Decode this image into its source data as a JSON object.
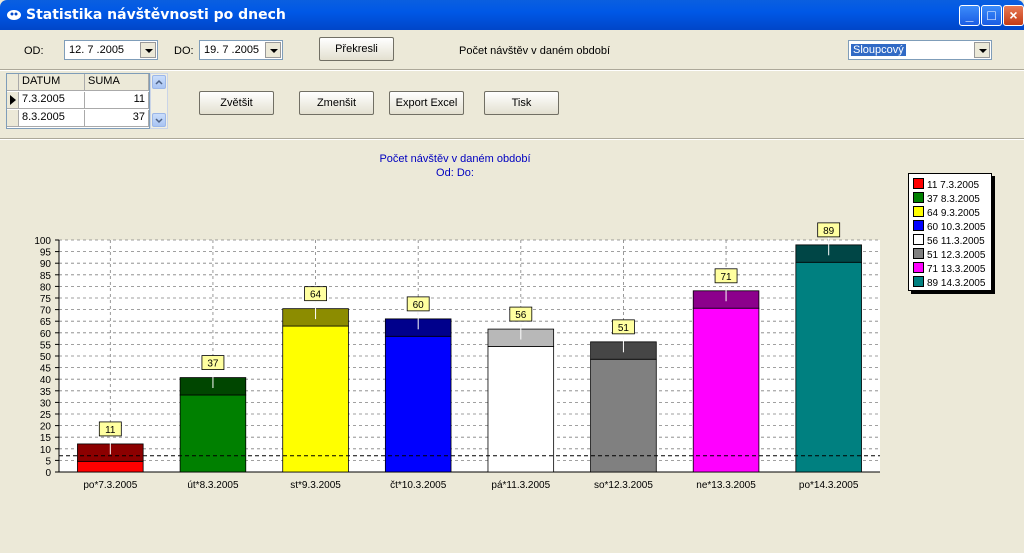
{
  "window": {
    "title": "Statistika návštěvnosti po dnech"
  },
  "filters": {
    "od_label": "OD:",
    "od_value": "12. 7 .2005",
    "do_label": "DO:",
    "do_value": "19. 7 .2005",
    "redraw_label": "Překresli",
    "period_label": "Počet návštěv v daném období",
    "chart_type_value": "Sloupcový"
  },
  "table": {
    "headers": [
      "DATUM",
      "SUMA"
    ],
    "rows": [
      {
        "datum": "7.3.2005",
        "suma": "11"
      },
      {
        "datum": "8.3.2005",
        "suma": "37"
      }
    ]
  },
  "toolbar": {
    "zoom_in": "Zvětšit",
    "zoom_out": "Zmenšit",
    "export": "Export Excel",
    "print": "Tisk"
  },
  "chart_data": {
    "type": "bar",
    "title": "Počet návštěv v daném období",
    "subtitle": "Od: Do:",
    "categories": [
      "po*7.3.2005",
      "út*8.3.2005",
      "st*9.3.2005",
      "čt*10.3.2005",
      "pá*11.3.2005",
      "so*12.3.2005",
      "ne*13.3.2005",
      "po*14.3.2005"
    ],
    "values": [
      11,
      37,
      64,
      60,
      56,
      51,
      71,
      89
    ],
    "colors": [
      "#FF0000",
      "#008000",
      "#FFFF00",
      "#0000FF",
      "#FFFFFF",
      "#808080",
      "#FF00FF",
      "#008080"
    ],
    "legend": [
      "11 7.3.2005",
      "37 8.3.2005",
      "64 9.3.2005",
      "60 10.3.2005",
      "56 11.3.2005",
      "51 12.3.2005",
      "71 13.3.2005",
      "89 14.3.2005"
    ],
    "yticks": [
      0,
      5,
      10,
      15,
      20,
      25,
      30,
      35,
      40,
      45,
      50,
      55,
      60,
      65,
      70,
      75,
      80,
      85,
      90,
      95,
      100
    ],
    "ylim": [
      0,
      100
    ],
    "grid": true,
    "legend_position": "right"
  }
}
